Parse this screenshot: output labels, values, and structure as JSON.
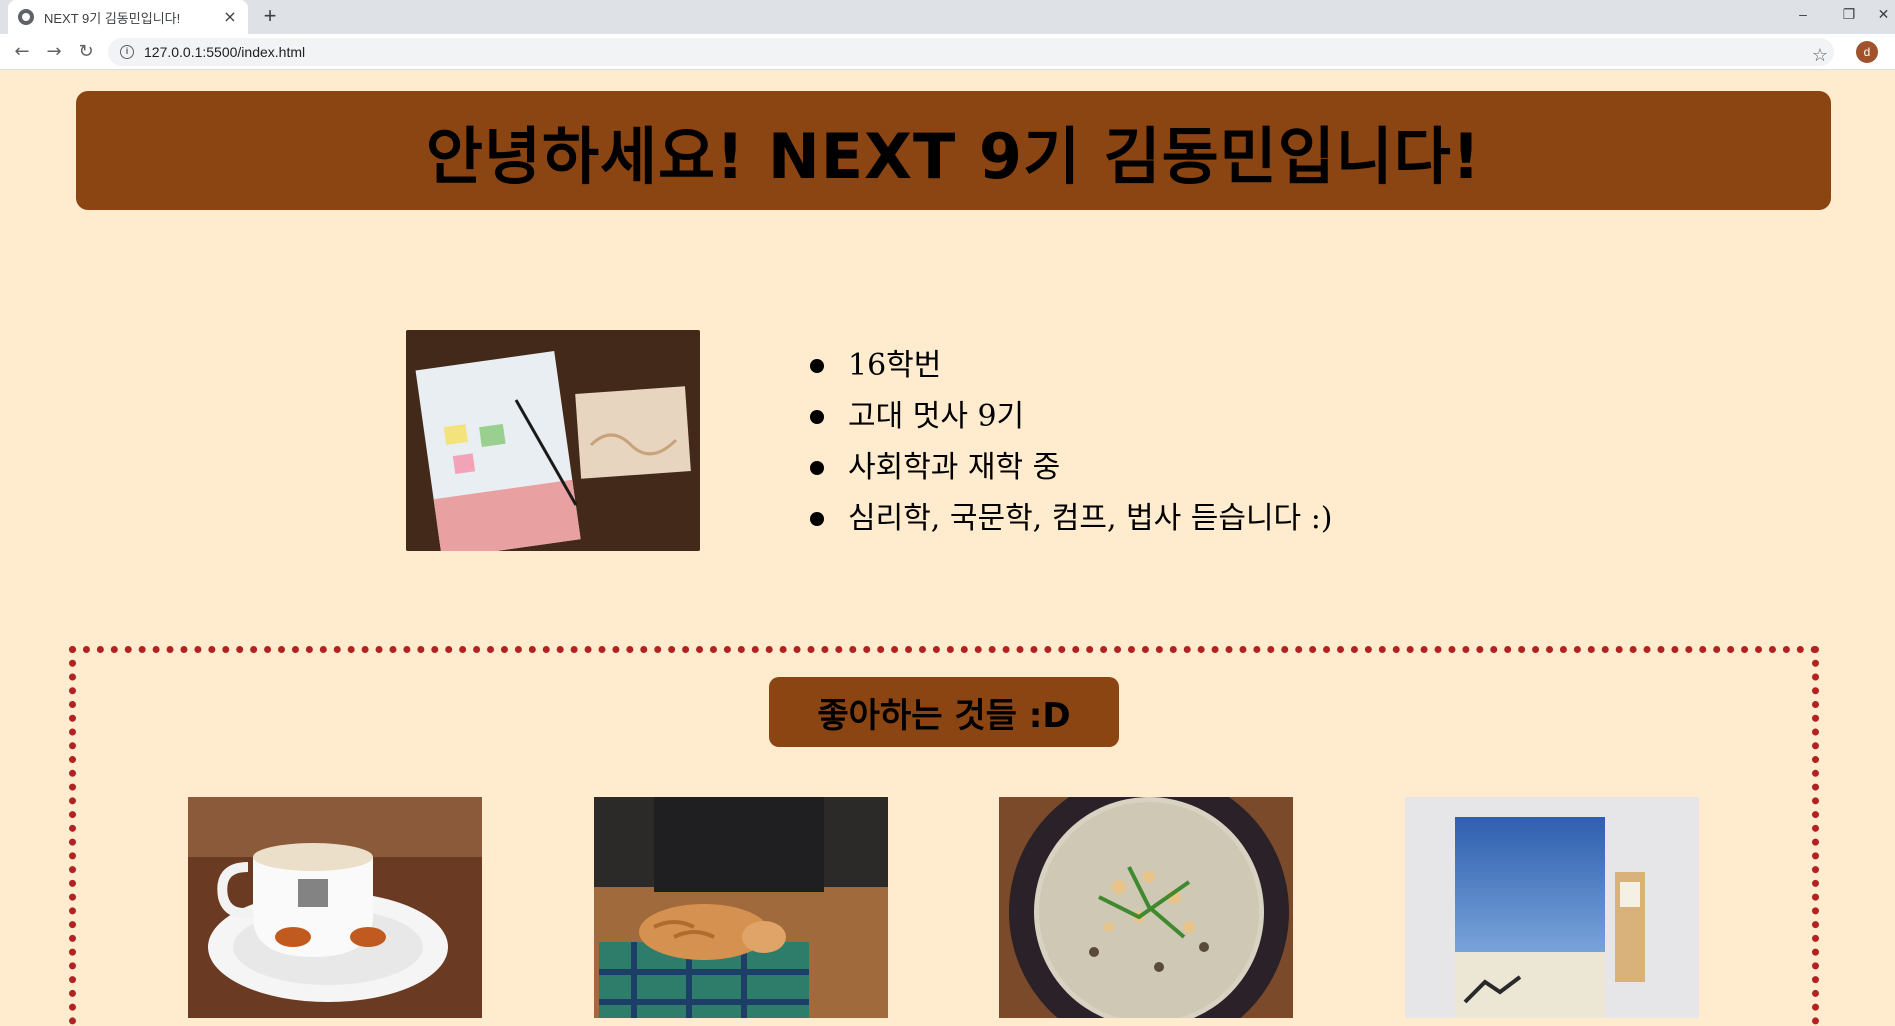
{
  "browser": {
    "tab_title": "NEXT 9기 김동민입니다!",
    "tab_close": "×",
    "new_tab": "+",
    "url": "127.0.0.1:5500/index.html",
    "profile_initial": "d",
    "controls": {
      "minimize": "–",
      "restore": "❐",
      "close": "✕"
    },
    "nav": {
      "back": "←",
      "forward": "→",
      "reload": "↻"
    },
    "star": "☆"
  },
  "page": {
    "heading": "안녕하세요! NEXT 9기 김동민입니다!",
    "intro_items": [
      "16학번",
      "고대 멋사 9기",
      "사회학과 재학 중",
      "심리학, 국문학, 컴프, 법사 듣습니다 :)"
    ],
    "likes_title": "좋아하는 것들 :D"
  },
  "colors": {
    "background": "#ffebcd",
    "banner": "#8b4513",
    "dotted_border": "#b22222"
  }
}
